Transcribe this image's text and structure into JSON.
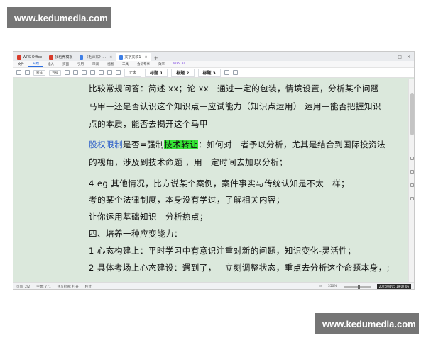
{
  "watermarks": {
    "top_left": "www.kedumedia.com",
    "bottom_right": "www.kedumedia.com"
  },
  "tabs": [
    {
      "label": "WPS Office",
      "icon": "wps-logo-icon"
    },
    {
      "label": "找稻壳模板",
      "icon": "template-icon"
    },
    {
      "label": "《毛泽东》...",
      "icon": "doc-icon"
    },
    {
      "label": "文字文稿1",
      "icon": "doc-icon",
      "active": true
    }
  ],
  "menu": {
    "file": "文件",
    "items": [
      "开始",
      "插入",
      "页面",
      "引用",
      "审阅",
      "视图",
      "工具",
      "会员专享",
      "效率"
    ],
    "wps_ai": "WPS AI"
  },
  "ribbon": {
    "styles": [
      "正文",
      "标题 1",
      "标题 2",
      "标题 3"
    ],
    "font_size_label": "五号",
    "font_name": "宋体"
  },
  "document": {
    "lines": [
      "比较常规问答：简述 xx；论 xx—通过一定的包装，情境设置，分析某个问题",
      "马甲—还是否认识这个知识点—应试能力（知识点运用）  运用—能否把握知识",
      "点的本质，能否去揭开这个马甲",
      "股权限制是否=强制技术转让：如何对二者予以分析，尤其是结合到国际投资法",
      "的视角，涉及到技术命题 ，用一定时间去加以分析；",
      "4 eg 其他情况，比方说某个案例，案件事实与传统认知是不太一样；",
      "考的某个法律制度，本身没有学过，了解相关内容；",
      "让你运用基础知识—分析热点；",
      "四、培养一种应变能力：",
      "1 心态构建上：平时学习中有意识注重对新的问题，知识变化-灵活性；",
      "2 具体考场上心态建设：遇到了，—立刻调整状态，重点去分析这个命题本身，;"
    ],
    "line4_parts": {
      "blue": "股权限制",
      "mid": "是否=强制",
      "highlight": "技术转让",
      "rest": "：如何对二者予以分析，尤其是结合到国际投资法"
    }
  },
  "status": {
    "page": "页面: 2/2",
    "words": "字数: 771",
    "spell": "拼写检查: 打开",
    "proof": "校对",
    "zoom": "350%",
    "clock": "2025/04/15 19:07:06"
  },
  "colors": {
    "page_bg": "#dbe8dc",
    "highlight": "#34e434",
    "link_blue": "#2d5fc9"
  }
}
